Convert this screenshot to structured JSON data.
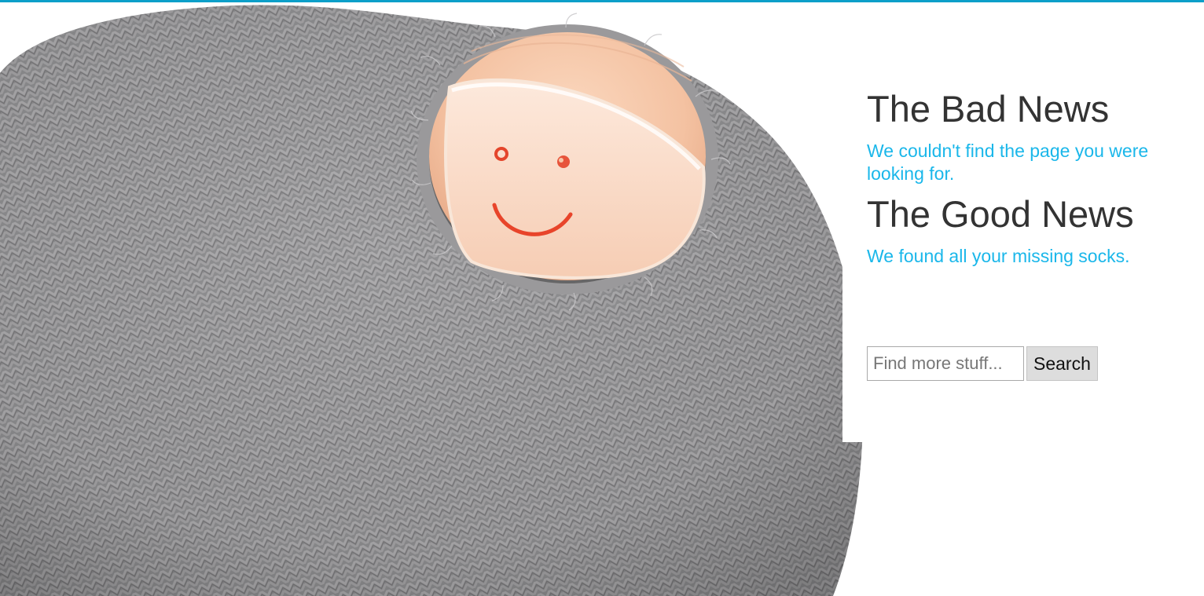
{
  "colors": {
    "accent": "#1ab7ea",
    "top_bar": "#0c9fc9",
    "heading": "#333333"
  },
  "hero": {
    "image_icon": "sock-toe-smiley-icon"
  },
  "bad_news": {
    "title": "The Bad News",
    "text": "We couldn't find the page you were looking for."
  },
  "good_news": {
    "title": "The Good News",
    "text": "We found all your missing socks."
  },
  "search": {
    "placeholder": "Find more stuff...",
    "value": "",
    "button_label": "Search"
  }
}
